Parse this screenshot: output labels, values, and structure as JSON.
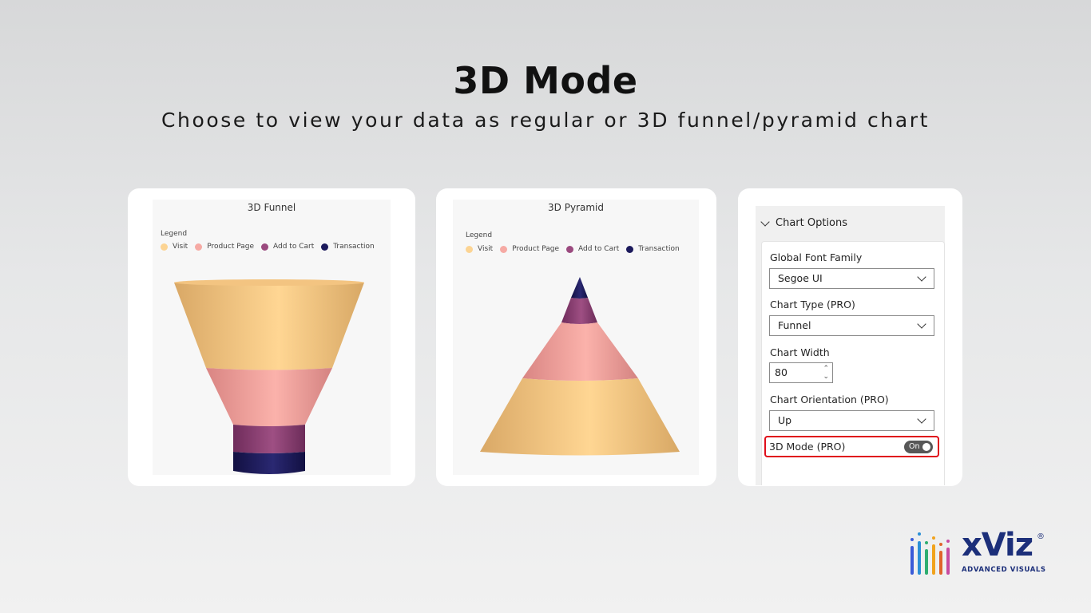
{
  "header": {
    "title": "3D Mode",
    "subtitle": "Choose to view your data as regular or 3D funnel/pyramid chart"
  },
  "legend": {
    "title": "Legend",
    "items": [
      {
        "label": "Visit",
        "color": "#fcd493"
      },
      {
        "label": "Product Page",
        "color": "#f6aaa4"
      },
      {
        "label": "Add to Cart",
        "color": "#9b4a7f"
      },
      {
        "label": "Transaction",
        "color": "#1c1a5c"
      }
    ]
  },
  "chart_data": [
    {
      "type": "funnel",
      "title": "3D Funnel",
      "mode": "3D",
      "categories": [
        "Visit",
        "Product Page",
        "Add to Cart",
        "Transaction"
      ],
      "colors": [
        "#fcd493",
        "#f6aaa4",
        "#9b4a7f",
        "#1c1a5c"
      ]
    },
    {
      "type": "pyramid",
      "title": "3D Pyramid",
      "mode": "3D",
      "categories": [
        "Visit",
        "Product Page",
        "Add to Cart",
        "Transaction"
      ],
      "colors": [
        "#fcd493",
        "#f6aaa4",
        "#9b4a7f",
        "#1c1a5c"
      ]
    }
  ],
  "settings": {
    "section_title": "Chart Options",
    "font_family_label": "Global Font Family",
    "font_family_value": "Segoe UI",
    "chart_type_label": "Chart Type (PRO)",
    "chart_type_value": "Funnel",
    "chart_width_label": "Chart Width",
    "chart_width_value": "80",
    "orientation_label": "Chart Orientation (PRO)",
    "orientation_value": "Up",
    "mode_3d_label": "3D Mode (PRO)",
    "mode_3d_state": "On",
    "highlight_color": "#e00d1a"
  },
  "brand": {
    "name": "xViz",
    "registered": "®",
    "tagline": "ADVANCED VISUALS",
    "color": "#1c2f7a"
  }
}
